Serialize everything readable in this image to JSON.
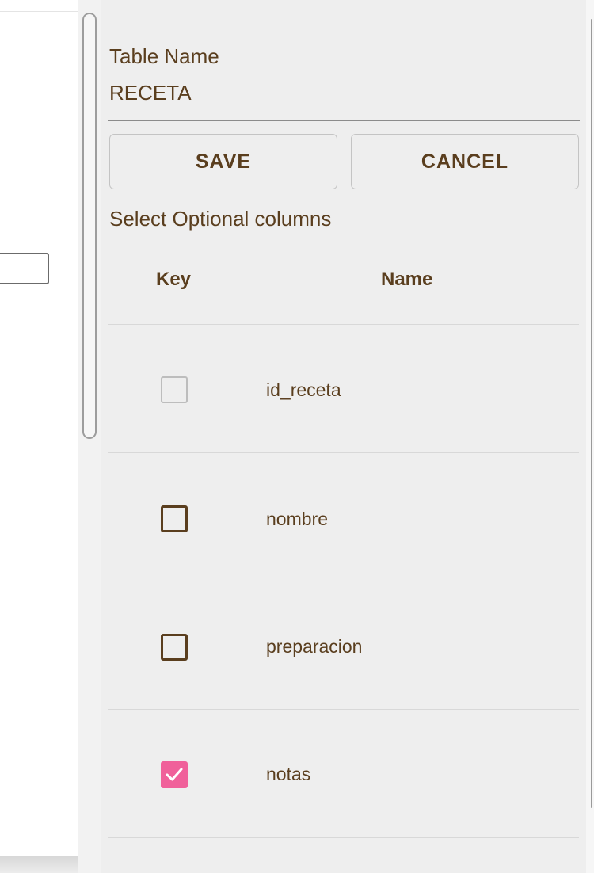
{
  "table": {
    "name_label": "Table Name",
    "name_value": "RECETA"
  },
  "actions": {
    "save_label": "SAVE",
    "cancel_label": "CANCEL"
  },
  "columns_section": {
    "label": "Select Optional columns",
    "headers": {
      "key": "Key",
      "name": "Name"
    },
    "rows": [
      {
        "name": "id_receta",
        "key_checked": false,
        "key_disabled": true
      },
      {
        "name": "nombre",
        "key_checked": false,
        "key_disabled": false
      },
      {
        "name": "preparacion",
        "key_checked": false,
        "key_disabled": false
      },
      {
        "name": "notas",
        "key_checked": true,
        "key_disabled": false
      }
    ]
  },
  "colors": {
    "text": "#5a3e1e",
    "panel_bg": "#eeeeee",
    "checked_accent": "#f0609a"
  },
  "icons": {
    "checkmark": "check-icon"
  }
}
